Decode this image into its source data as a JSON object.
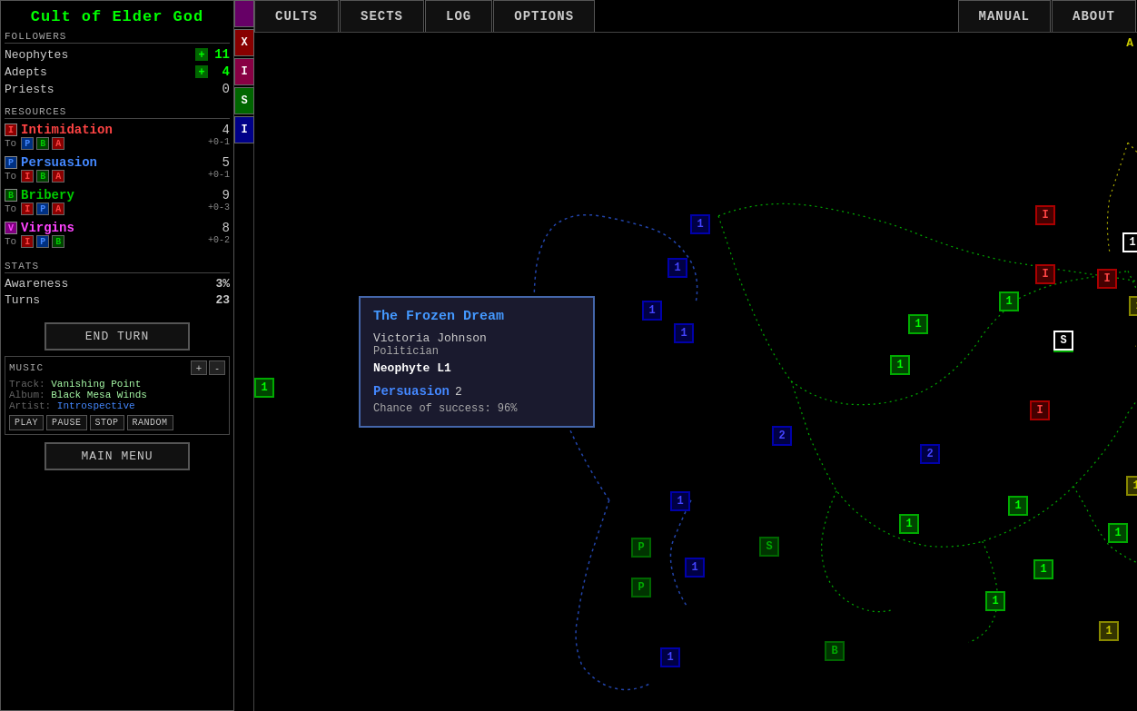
{
  "cult": {
    "name": "Cult of Elder God"
  },
  "followers": {
    "label": "FOLLOWERS",
    "items": [
      {
        "name": "Neophytes",
        "count": "11",
        "has_plus": true,
        "count_color": "green"
      },
      {
        "name": "Adepts",
        "count": "4",
        "has_plus": true,
        "count_color": "green"
      },
      {
        "name": "Priests",
        "count": "0",
        "has_plus": false,
        "count_color": "plain"
      }
    ]
  },
  "resources": {
    "label": "RESOURCES",
    "items": [
      {
        "badge": "I",
        "badge_class": "badge-i",
        "name": "Intimidation",
        "name_class": "res-intimidation",
        "value": "4",
        "delta": "+0-1",
        "to": [
          "P",
          "B",
          "A"
        ],
        "to_classes": [
          "badge-p",
          "badge-b",
          "badge-i"
        ]
      },
      {
        "badge": "P",
        "badge_class": "badge-p",
        "name": "Persuasion",
        "name_class": "res-persuasion",
        "value": "5",
        "delta": "+0-1",
        "to": [
          "I",
          "B",
          "A"
        ],
        "to_classes": [
          "badge-i",
          "badge-b",
          "badge-i"
        ]
      },
      {
        "badge": "B",
        "badge_class": "badge-b",
        "name": "Bribery",
        "name_class": "res-bribery",
        "value": "9",
        "delta": "+0-3",
        "to": [
          "I",
          "P",
          "A"
        ],
        "to_classes": [
          "badge-i",
          "badge-p",
          "badge-i"
        ]
      },
      {
        "badge": "V",
        "badge_class": "badge-v",
        "name": "Virgins",
        "name_class": "res-virgins",
        "value": "8",
        "delta": "+0-2",
        "to": [
          "I",
          "P",
          "B"
        ],
        "to_classes": [
          "badge-i",
          "badge-p",
          "badge-b"
        ]
      }
    ]
  },
  "stats": {
    "label": "STATS",
    "awareness_label": "Awareness",
    "awareness_value": "3%",
    "turns_label": "Turns",
    "turns_value": "23"
  },
  "buttons": {
    "end_turn": "END TURN",
    "main_menu": "MAIN MENU"
  },
  "music": {
    "label": "MUSIC",
    "track_label": "Track:",
    "track": "Vanishing Point",
    "album_label": "Album:",
    "album": "Black Mesa Winds",
    "artist_label": "Artist:",
    "artist": "Introspective",
    "vol_plus": "+",
    "vol_minus": "-",
    "play": "PLAY",
    "pause": "PAUSE",
    "stop": "STOP",
    "random": "RANDOM"
  },
  "side_tabs": [
    {
      "label": "",
      "class": "side-tab-purple"
    },
    {
      "label": "X",
      "class": "side-tab-red"
    },
    {
      "label": "I",
      "class": "side-tab-magenta"
    },
    {
      "label": "S",
      "class": "side-tab-green"
    },
    {
      "label": "I",
      "class": "side-tab-blue"
    }
  ],
  "nav_tabs": [
    {
      "label": "CULTS",
      "align": "left"
    },
    {
      "label": "SECTS",
      "align": "left"
    },
    {
      "label": "LOG",
      "align": "left"
    },
    {
      "label": "OPTIONS",
      "align": "left"
    },
    {
      "label": "MANUAL",
      "align": "right"
    },
    {
      "label": "ABOUT",
      "align": "right"
    }
  ],
  "popup": {
    "title": "The Frozen Dream",
    "name": "Victoria Johnson",
    "role": "Politician",
    "rank": "Neophyte L1",
    "resource_name": "Persuasion",
    "resource_value": "2",
    "chance": "Chance of success: 96%"
  },
  "map": {
    "corner_label": "A"
  }
}
